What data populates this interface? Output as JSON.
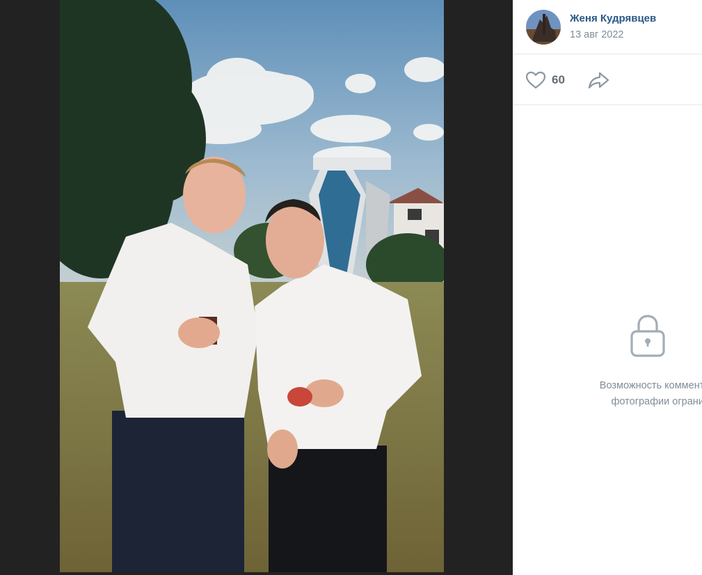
{
  "author": {
    "name": "Женя Кудрявцев",
    "date": "13 авг 2022",
    "avatar_icon": "avatar-image"
  },
  "actions": {
    "likes": "60",
    "like_icon": "heart-icon",
    "share_icon": "share-icon"
  },
  "comments": {
    "restricted_line1": "Возможность комментирова",
    "restricted_line2": "фотографии ограничен",
    "lock_icon": "lock-icon"
  },
  "colors": {
    "link": "#2a5885",
    "secondary": "#818c99",
    "viewer_bg": "#222222"
  }
}
